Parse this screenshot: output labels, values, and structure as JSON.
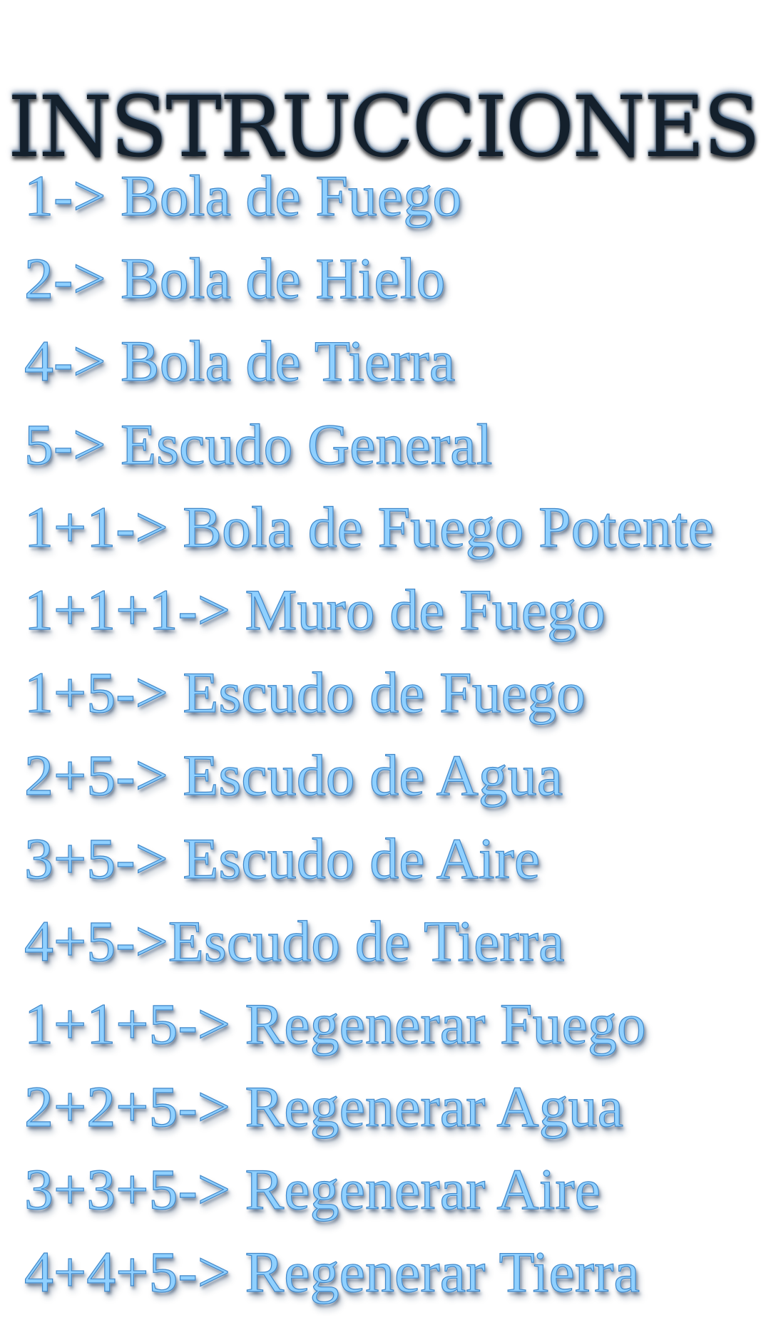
{
  "title": "INSTRUCCIONES",
  "instructions": [
    "1-> Bola de Fuego",
    "2-> Bola de Hielo",
    "4-> Bola de Tierra",
    "5-> Escudo General",
    "1+1-> Bola de Fuego Potente",
    "1+1+1-> Muro de Fuego",
    "1+5-> Escudo de Fuego",
    "2+5-> Escudo de Agua",
    "3+5-> Escudo de Aire",
    "4+5->Escudo de Tierra",
    "1+1+5-> Regenerar Fuego",
    "2+2+5-> Regenerar Agua",
    "3+3+5-> Regenerar Aire",
    "4+4+5-> Regenerar Tierra"
  ],
  "colors": {
    "background": "#ffffff",
    "title": "#14202c",
    "text": "#8fd0ff",
    "text_outline": "#3f86c8"
  }
}
